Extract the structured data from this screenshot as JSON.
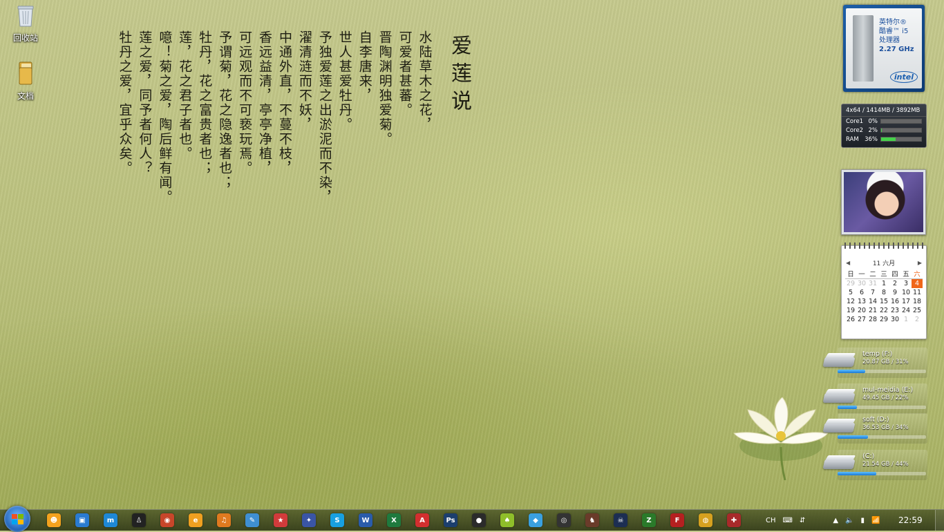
{
  "desktop_icons": [
    {
      "label": "回收站",
      "icon": "recycle-bin-icon"
    },
    {
      "label": "文档",
      "icon": "folder-icon"
    }
  ],
  "poem": {
    "title": "爱莲说",
    "lines": [
      "水陆草木之花，",
      "可爱者甚蕃。",
      "晋陶渊明独爱菊。",
      "自李唐来，",
      "世人甚爱牡丹。",
      "予独爱莲之出淤泥而不染，",
      "濯清涟而不妖，",
      "中通外直，不蔓不枝，",
      "香远益清，亭亭净植，",
      "可远观而不可亵玩焉。",
      "予谓菊，花之隐逸者也；",
      "牡丹，花之富贵者也；",
      "莲，花之君子者也。",
      "噫！菊之爱，陶后鲜有闻。",
      "莲之爱，同予者何人？",
      "牡丹之爱，宜乎众矣。"
    ]
  },
  "cpu_gadget": {
    "brand_line1": "英特尔®",
    "brand_line2": "酷睿™ i5",
    "brand_line3": "处理器",
    "speed": "2.27 GHz",
    "logo": "intel"
  },
  "meter_gadget": {
    "header": "4x64 / 1414MB / 3892MB",
    "rows": [
      {
        "name": "Core1",
        "value": "0%",
        "level": 0
      },
      {
        "name": "Core2",
        "value": "2%",
        "level": 2
      },
      {
        "name": "RAM",
        "value": "36%",
        "level": 36
      }
    ]
  },
  "calendar": {
    "title": "11 六月",
    "weekdays": [
      "日",
      "一",
      "二",
      "三",
      "四",
      "五",
      "六"
    ],
    "weeks": [
      [
        "29",
        "30",
        "31",
        "1",
        "2",
        "3",
        "4"
      ],
      [
        "5",
        "6",
        "7",
        "8",
        "9",
        "10",
        "11"
      ],
      [
        "12",
        "13",
        "14",
        "15",
        "16",
        "17",
        "18"
      ],
      [
        "19",
        "20",
        "21",
        "22",
        "23",
        "24",
        "25"
      ],
      [
        "26",
        "27",
        "28",
        "29",
        "30",
        "1",
        "2"
      ]
    ],
    "today": "4"
  },
  "drives": [
    {
      "name": "temp (F:)",
      "info": "20.87 GB / 31%",
      "used": 31
    },
    {
      "name": "mul-meidia (E:)",
      "info": "49.45 GB / 22%",
      "used": 22
    },
    {
      "name": "soft (D:)",
      "info": "36.53 GB / 34%",
      "used": 34
    },
    {
      "name": "(C:)",
      "info": "21.54 GB / 44%",
      "used": 44
    }
  ],
  "taskbar": {
    "apps": [
      {
        "name": "app-orange-face-icon",
        "color": "#f4a21e",
        "glyph": "☻"
      },
      {
        "name": "app-window-icon",
        "color": "#2a7bd1",
        "glyph": "▣"
      },
      {
        "name": "app-maxthon-icon",
        "color": "#1e88d6",
        "glyph": "m"
      },
      {
        "name": "app-qq-icon",
        "color": "#222222",
        "glyph": "♙"
      },
      {
        "name": "app-sphere-icon",
        "color": "#c8462a",
        "glyph": "◉"
      },
      {
        "name": "app-orange-e-icon",
        "color": "#f0a020",
        "glyph": "e"
      },
      {
        "name": "app-guitar-icon",
        "color": "#e07a1f",
        "glyph": "♫"
      },
      {
        "name": "app-tool-icon",
        "color": "#3f8fd2",
        "glyph": "✎"
      },
      {
        "name": "app-star-icon",
        "color": "#d23b3b",
        "glyph": "★"
      },
      {
        "name": "app-starblue-icon",
        "color": "#3a55a5",
        "glyph": "✦"
      },
      {
        "name": "app-skype-icon",
        "color": "#18a0e0",
        "glyph": "S"
      },
      {
        "name": "app-word-icon",
        "color": "#2a5caa",
        "glyph": "W"
      },
      {
        "name": "app-excel-icon",
        "color": "#1f7a3e",
        "glyph": "X"
      },
      {
        "name": "app-acrobat-icon",
        "color": "#d32f2f",
        "glyph": "A"
      },
      {
        "name": "app-photoshop-icon",
        "color": "#1c3f6e",
        "glyph": "Ps"
      },
      {
        "name": "app-camera-icon",
        "color": "#2b2b2b",
        "glyph": "●"
      },
      {
        "name": "app-bird-icon",
        "color": "#8fbf2a",
        "glyph": "♠"
      },
      {
        "name": "app-cube-icon",
        "color": "#3aa0e0",
        "glyph": "◆"
      },
      {
        "name": "app-mask-icon",
        "color": "#333333",
        "glyph": "◎"
      },
      {
        "name": "app-knight-icon",
        "color": "#6a3b2a",
        "glyph": "♞"
      },
      {
        "name": "app-skull-icon",
        "color": "#1c2e52",
        "glyph": "☠"
      },
      {
        "name": "app-z-icon",
        "color": "#2a7a2a",
        "glyph": "Z"
      },
      {
        "name": "app-f-icon",
        "color": "#b52020",
        "glyph": "F"
      },
      {
        "name": "app-coin-icon",
        "color": "#d6a11f",
        "glyph": "◍"
      },
      {
        "name": "app-shield-icon",
        "color": "#a82a2a",
        "glyph": "✚"
      }
    ],
    "lang": "CH",
    "time": "22:59"
  }
}
